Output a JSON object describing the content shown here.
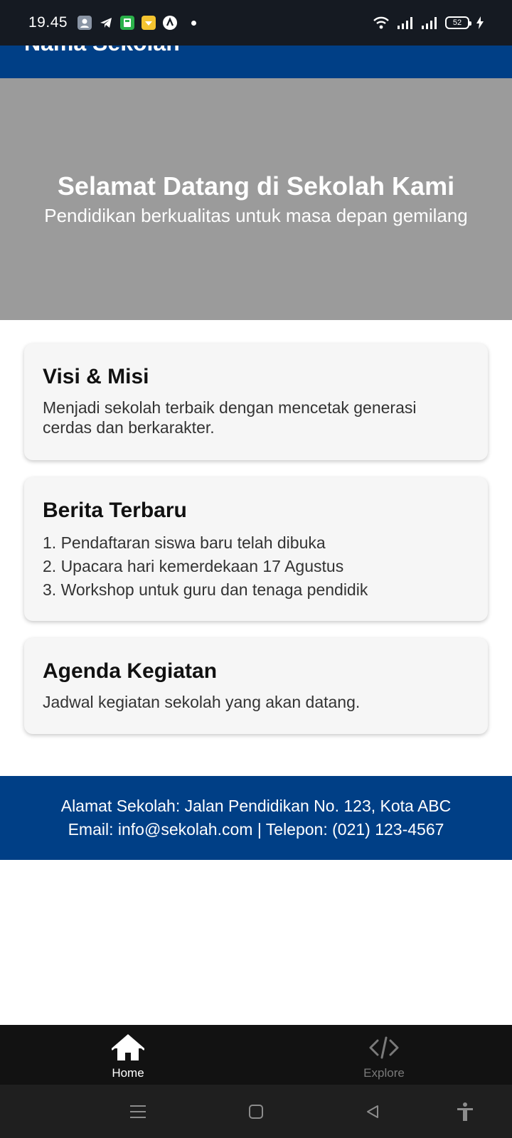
{
  "status_bar": {
    "time": "19.45",
    "battery_level": "52",
    "notification_icons": [
      "contact-icon",
      "telegram-icon",
      "calculator-icon",
      "discount-app-icon",
      "app-icon"
    ],
    "system_icons": [
      "wifi-icon",
      "signal-icon",
      "signal-icon",
      "battery-icon",
      "charging-icon"
    ]
  },
  "header": {
    "title": "Nama Sekolah"
  },
  "hero": {
    "title": "Selamat Datang di Sekolah Kami",
    "subtitle": "Pendidikan berkualitas untuk masa depan gemilang"
  },
  "cards": {
    "visi": {
      "title": "Visi & Misi",
      "text": "Menjadi sekolah terbaik dengan mencetak generasi cerdas dan berkarakter."
    },
    "berita": {
      "title": "Berita Terbaru",
      "items": [
        "1. Pendaftaran siswa baru telah dibuka",
        "2. Upacara hari kemerdekaan 17 Agustus",
        "3. Workshop untuk guru dan tenaga pendidik"
      ]
    },
    "agenda": {
      "title": "Agenda Kegiatan",
      "text": "Jadwal kegiatan sekolah yang akan datang."
    }
  },
  "footer": {
    "address": "Alamat Sekolah: Jalan Pendidikan No. 123, Kota ABC",
    "contact": "Email: info@sekolah.com | Telepon: (021) 123-4567"
  },
  "tab_bar": {
    "tabs": [
      {
        "label": "Home",
        "icon": "home-icon",
        "active": true
      },
      {
        "label": "Explore",
        "icon": "code-icon",
        "active": false
      }
    ]
  },
  "nav_bar": {
    "buttons": [
      "menu-icon",
      "home-square-icon",
      "back-icon",
      "accessibility-icon"
    ]
  },
  "colors": {
    "primary": "#003f86",
    "hero_bg": "#9b9b9b",
    "card_bg": "#f6f6f6",
    "status_bar_bg": "#151a22",
    "tab_bar_bg": "#121212"
  }
}
